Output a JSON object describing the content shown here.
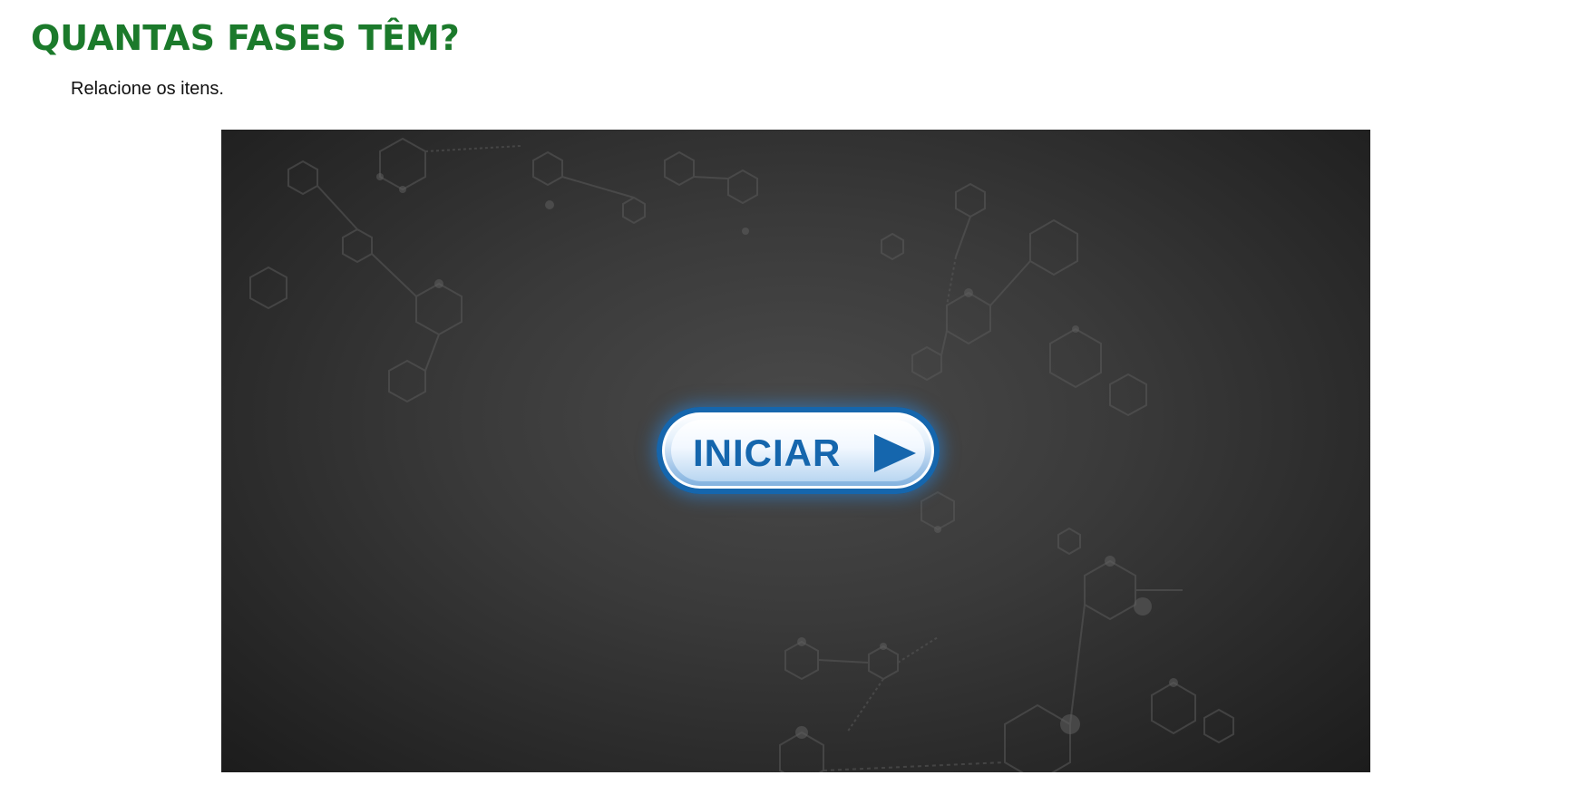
{
  "page": {
    "title": "QUANTAS FASES TÊM?",
    "instructions": "Relacione os itens."
  },
  "activity": {
    "start_label": "INICIAR",
    "start_icon": "play-triangle-icon",
    "background": "molecular-hexagon-pattern"
  },
  "colors": {
    "title": "#1b7a2b",
    "button_border": "#1566ad",
    "button_text": "#1566ad"
  }
}
